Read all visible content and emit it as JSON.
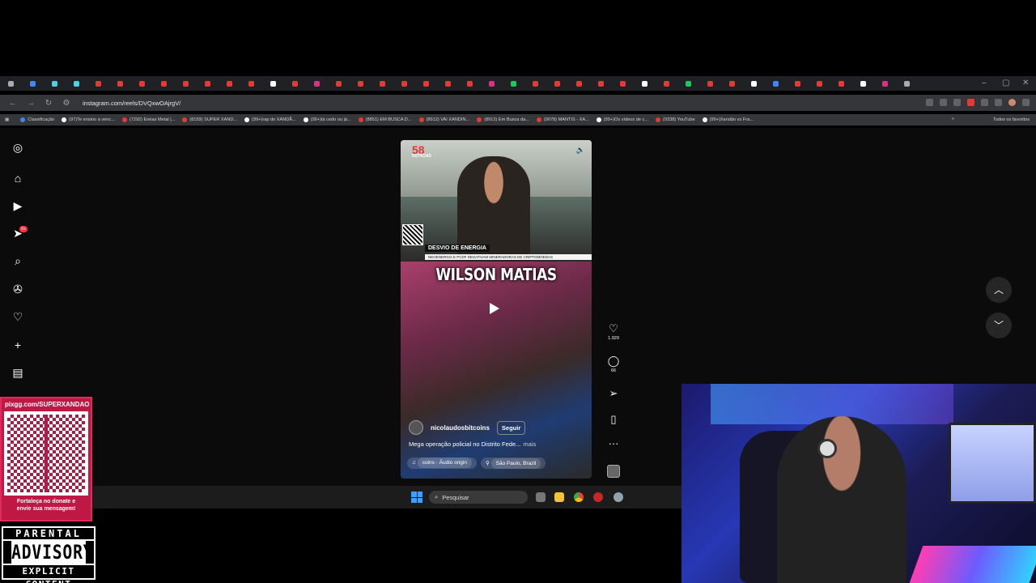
{
  "browser": {
    "url": "instagram.com/reels/DVQxwOAjrgV/",
    "bookmarks": [
      "Classificação",
      "(97)Te ensino a venc...",
      "(7292) Enéas Metal |...",
      "(8159) SUPER XAND...",
      "(99+)rap do XANDÃ...",
      "(99+)tá cedo ou já...",
      "(8851) EM BUSCA D...",
      "(8912) VAI XANDIN...",
      "(8912) Em Busca da...",
      "(9078) MANTIS - XA...",
      "(99+)Os vídeos de c...",
      "(9338) YouTube",
      "(99+)Xandão vs Fra..."
    ],
    "all_bookmarks_label": "Todos os favoritos"
  },
  "reel": {
    "news_logo": "58",
    "news_logo_sub": "NOTÍCIAS",
    "lower_third_title": "DESVIO DE ENERGIA",
    "lower_third_sub": "NEOENERGIA E PCDF DESATIVAM MINERADORAS DE CRIPTOMOEDAS",
    "caption": "WILSON MATIAS",
    "author": "nicolaudosbitcoins",
    "follow_label": "Seguir",
    "description": "Mega operação policial no Distrito Fede...",
    "more_label": "mais",
    "audio": "coins · Áudio origin",
    "location": "São Paulo, Brazil"
  },
  "actions": {
    "likes": "1.929",
    "comments": "66"
  },
  "side_nav": {
    "badge": "9+"
  },
  "taskbar": {
    "search_placeholder": "Pesquisar"
  },
  "promo": {
    "url": "pixgg.com/SUPERXANDAO",
    "line1": "Fortaleça no donate e",
    "line2": "envie sua mensagem!"
  },
  "advisory": {
    "line1": "PARENTAL",
    "line2": "ADVISORY",
    "line3": "EXPLICIT CONTENT"
  },
  "colors": {
    "promo_bg": "#c01845",
    "chrome_bg": "#35363a",
    "accent_red": "#ff3040"
  }
}
